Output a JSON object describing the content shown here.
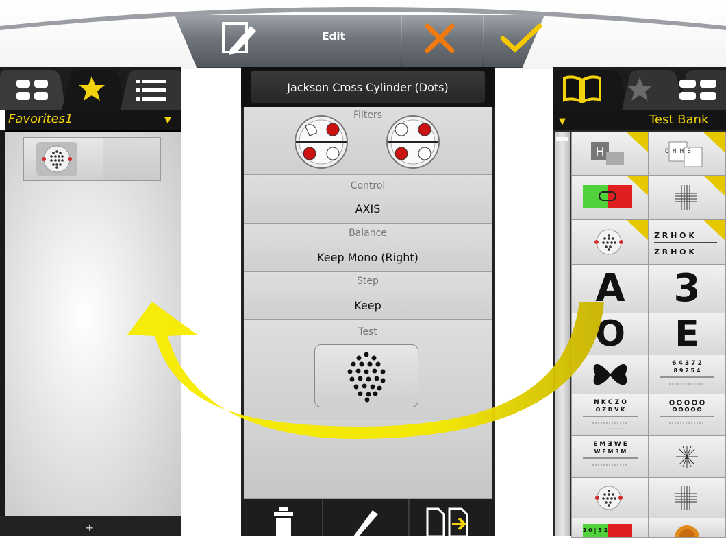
{
  "toolbar": {
    "edit_label": "Edit",
    "icons": [
      "edit-document-icon",
      "cancel-icon",
      "confirm-icon"
    ]
  },
  "left_panel": {
    "tabs": [
      "grid-view-icon",
      "favorites-star-icon",
      "list-view-icon"
    ],
    "active_tab": "favorites-star-icon",
    "title": "Favorites1",
    "dropdown_glyph": "▼",
    "items": [
      "jackson-cross-cylinder-dots-thumbnail"
    ],
    "footer_label": "+"
  },
  "center_panel": {
    "title": "Jackson Cross Cylinder (Dots)",
    "filters": {
      "label": "Filters",
      "icons": [
        "filter-left-icon",
        "filter-right-icon"
      ]
    },
    "control": {
      "label": "Control",
      "value": "AXIS"
    },
    "balance": {
      "label": "Balance",
      "value": "Keep Mono (Right)"
    },
    "step": {
      "label": "Step",
      "value": "Keep"
    },
    "test": {
      "label": "Test",
      "icon": "dots-pattern-icon"
    },
    "footer_actions": [
      "delete-icon",
      "edit-pencil-icon",
      "copy-export-icon"
    ]
  },
  "right_panel": {
    "tabs": [
      "book-icon",
      "star-icon",
      "grid-view-icon"
    ],
    "active_tab": "book-icon",
    "title": "Test Bank",
    "dropdown_glyph": "▼",
    "cells": {
      "r4c1": "A",
      "r4c2": "3",
      "r5c1": "O",
      "r5c2": "E",
      "r3c2_line1": "Z R H O K",
      "r3c2_line2": "Z R H O K",
      "r7c1_line1": "N K C Z O",
      "r7c1_line2": "O Z D V K",
      "r6c2_line1": "6 4 3 7 2",
      "r6c2_line2": "8 9 2 5 4",
      "r8c1_line1": "E M Ǝ W E",
      "r8c1_line2": "W E M Ǝ M",
      "r2c1_top": "3 0 | 5 2",
      "r1c1_letter": "H",
      "r1c2_letters": "O H H S"
    }
  },
  "colors": {
    "accent_yellow": "#f2d20c",
    "cancel_orange": "#f07a10",
    "confirm_yellow": "#f5c800",
    "arrow_yellow": "#f2e600"
  }
}
